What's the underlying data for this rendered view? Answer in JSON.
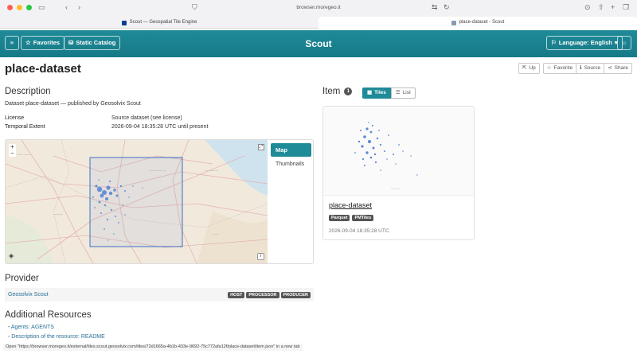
{
  "browser": {
    "address": "browser.moregeo.it",
    "tabs": [
      {
        "title": "Scout — Geospatial Tile Engine"
      },
      {
        "title": "place-dataset - Scout"
      }
    ]
  },
  "header": {
    "favorites_label": "Favorites",
    "catalog_label": "Static Catalog",
    "app_title": "Scout",
    "language_label": "Language: English"
  },
  "page": {
    "title": "place-dataset",
    "actions": {
      "up": "Up",
      "favorite": "Favorite",
      "source": "Source",
      "share": "Share"
    }
  },
  "description": {
    "heading": "Description",
    "text": "Dataset place-dataset — published by Geosolvix Scout",
    "license_label": "License",
    "license_value": "Source dataset (see license)",
    "temporal_label": "Temporal Extent",
    "temporal_value": "2026-09-04 18:35:28 UTC until present"
  },
  "map": {
    "map_button": "Map",
    "thumbnails_button": "Thumbnails",
    "zoom_in": "+",
    "zoom_out": "−"
  },
  "provider": {
    "heading": "Provider",
    "name": "Geosolvix Scout",
    "roles": [
      "HOST",
      "PROCESSOR",
      "PRODUCER"
    ]
  },
  "resources": {
    "heading": "Additional Resources",
    "items": [
      "Agents: AGENTS",
      "Description of the resource: README"
    ]
  },
  "items": {
    "heading": "Item",
    "count": "1",
    "view_tiles": "Tiles",
    "view_list": "List",
    "card": {
      "title": "place-dataset",
      "tags": [
        "Parquet",
        "PMTiles"
      ],
      "date": "2026-09-04 18:35:28 UTC"
    }
  },
  "statusbar": {
    "text": "Open \"https://browser.moregeo.it/external/tiles.scout.geosolvix.com/tiles/72d1665a-4b1b-433e-9692-75c772afa12f/place-dataset/item.json\" in a new tab"
  }
}
